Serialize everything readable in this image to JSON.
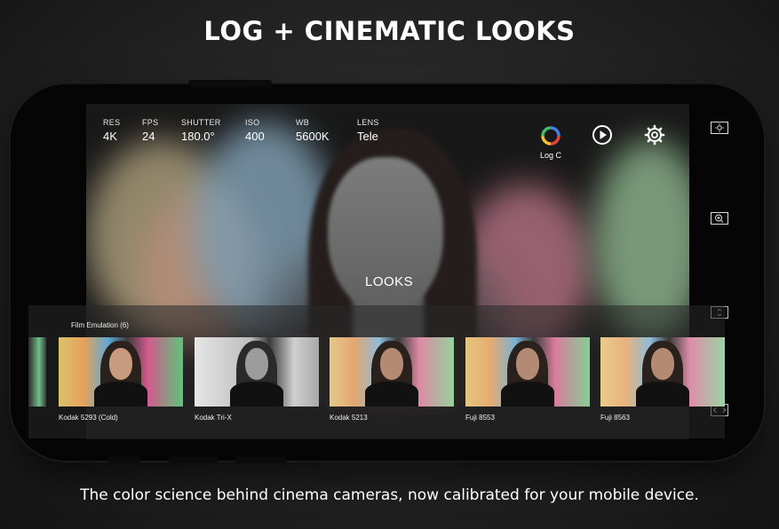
{
  "headline": "LOG + CINEMATIC LOOKS",
  "subline": "The color science behind cinema cameras, now calibrated for your mobile device.",
  "camera": {
    "stats": [
      {
        "label": "RES",
        "value": "4K"
      },
      {
        "label": "FPS",
        "value": "24"
      },
      {
        "label": "SHUTTER",
        "value": "180.0°"
      },
      {
        "label": "ISO",
        "value": "400"
      },
      {
        "label": "WB",
        "value": "5600K"
      },
      {
        "label": "LENS",
        "value": "Tele"
      }
    ],
    "log_label": "Log C",
    "looks_label": "LOOKS",
    "icons": [
      "color-wheel-icon",
      "play-icon",
      "gear-icon",
      "exposure-icon",
      "zoom-in-icon",
      "frame-icon",
      "expand-icon"
    ]
  },
  "film": {
    "title": "Film Emulation (6)",
    "items": [
      {
        "label": "Kodak 5293 (Cold)"
      },
      {
        "label": "Kodak Tri-X"
      },
      {
        "label": "Kodak 5213"
      },
      {
        "label": "Fuji 8553"
      },
      {
        "label": "Fuji 8563"
      }
    ]
  },
  "colors": {
    "accent_white": "#ffffff",
    "phone_body": "#050505"
  }
}
